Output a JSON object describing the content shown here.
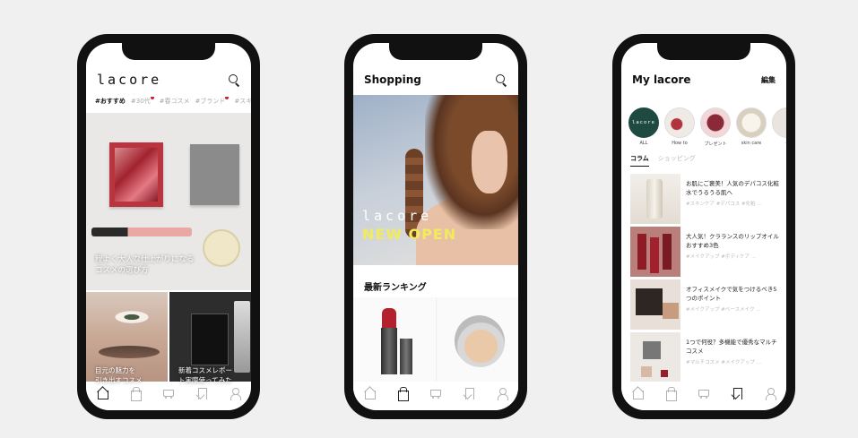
{
  "phone1": {
    "logo": "lacore",
    "tags": [
      {
        "label": "#おすすめ",
        "active": true,
        "dot": false
      },
      {
        "label": "#30代",
        "active": false,
        "dot": true
      },
      {
        "label": "#春コスメ",
        "active": false,
        "dot": false
      },
      {
        "label": "#ブランド",
        "active": false,
        "dot": true
      },
      {
        "label": "#スキ",
        "active": false,
        "dot": false
      }
    ],
    "hero_caption_line1": "程よく大人な仕上がりになる",
    "hero_caption_line2": "コスメの選び方",
    "card1_caption_line1": "目元の魅力を",
    "card1_caption_line2": "引き出すコスメ",
    "card2_caption_line1": "新着コスメレポー",
    "card2_caption_line2": "ト実際使ってみた"
  },
  "phone2": {
    "title": "Shopping",
    "banner_logo": "lacore",
    "banner_tagline": "NEW OPEN",
    "ranking_title": "最新ランキング"
  },
  "phone3": {
    "title": "My lacore",
    "edit_label": "編集",
    "circles": [
      {
        "label": "ALL",
        "inner": "lacore"
      },
      {
        "label": "How to",
        "inner": ""
      },
      {
        "label": "プレゼント",
        "inner": ""
      },
      {
        "label": "skin care",
        "inner": ""
      },
      {
        "label": "e",
        "inner": ""
      }
    ],
    "subtabs": [
      {
        "label": "コラム",
        "active": true
      },
      {
        "label": "ショッピング",
        "active": false
      }
    ],
    "articles": [
      {
        "title": "お肌にご褒美！人気のデパコス化粧水でうるうる肌へ",
        "meta": "#スキンケア #デパコス #化粧 …"
      },
      {
        "title": "大人気！クラランスのリップオイルおすすめ3色",
        "meta": "#メイクアップ #ボディケア …"
      },
      {
        "title": "オフィスメイクで気をつけるべき5つのポイント",
        "meta": "#メイクアップ #ベースメイク …"
      },
      {
        "title": "1つで何役？多機能で優秀なマルチコスメ",
        "meta": "#マルチコスメ #メイクアップ …"
      }
    ]
  },
  "colors": {
    "accent_dark_green": "#1f4a41",
    "banner_yellow": "#f2ec5a",
    "tag_dot": "#d0203a"
  }
}
